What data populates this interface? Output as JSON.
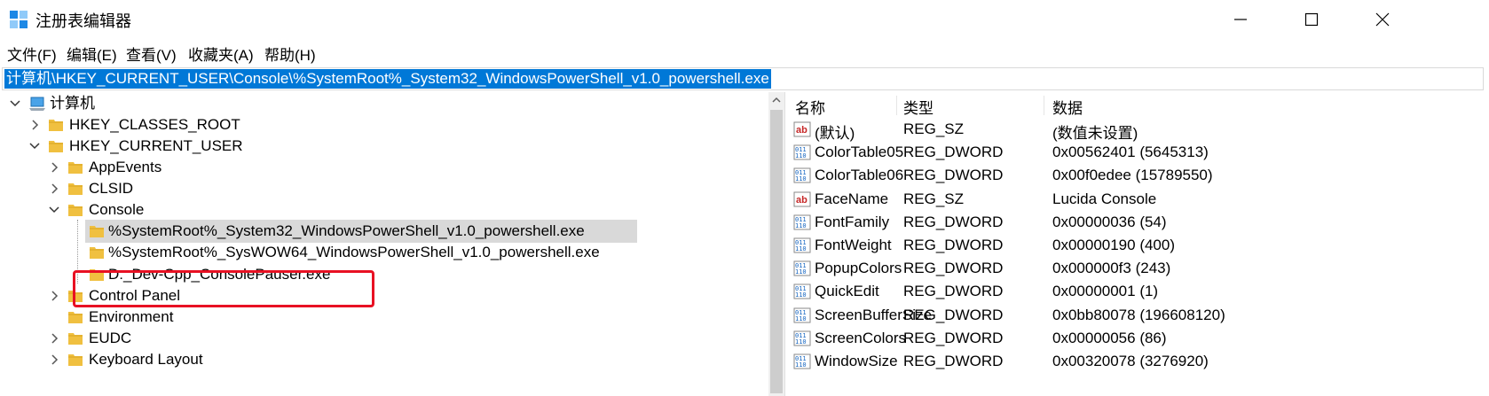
{
  "window": {
    "title": "注册表编辑器"
  },
  "menu": [
    {
      "label": "文件(F)"
    },
    {
      "label": "编辑(E)"
    },
    {
      "label": "查看(V)"
    },
    {
      "label": "收藏夹(A)"
    },
    {
      "label": "帮助(H)"
    }
  ],
  "address": "计算机\\HKEY_CURRENT_USER\\Console\\%SystemRoot%_System32_WindowsPowerShell_v1.0_powershell.exe",
  "tree": {
    "root": "计算机",
    "items": [
      {
        "label": "HKEY_CLASSES_ROOT",
        "state": "collapsed"
      },
      {
        "label": "HKEY_CURRENT_USER",
        "state": "expanded"
      },
      {
        "label": "AppEvents",
        "state": "collapsed"
      },
      {
        "label": "CLSID",
        "state": "collapsed"
      },
      {
        "label": "Console",
        "state": "expanded"
      },
      {
        "label": "%SystemRoot%_System32_WindowsPowerShell_v1.0_powershell.exe",
        "state": "selected"
      },
      {
        "label": "%SystemRoot%_SysWOW64_WindowsPowerShell_v1.0_powershell.exe",
        "state": "leaf"
      },
      {
        "label": "D:_Dev-Cpp_ConsolePauser.exe",
        "state": "leaf"
      },
      {
        "label": "Control Panel",
        "state": "collapsed"
      },
      {
        "label": "Environment",
        "state": "leaf"
      },
      {
        "label": "EUDC",
        "state": "collapsed"
      },
      {
        "label": "Keyboard Layout",
        "state": "collapsed"
      }
    ]
  },
  "columns": {
    "name": "名称",
    "type": "类型",
    "data": "数据"
  },
  "values": [
    {
      "name": "(默认)",
      "type": "REG_SZ",
      "data": "(数值未设置)",
      "icon": "string-value-icon"
    },
    {
      "name": "ColorTable05",
      "type": "REG_DWORD",
      "data": "0x00562401 (5645313)",
      "icon": "binary-value-icon"
    },
    {
      "name": "ColorTable06",
      "type": "REG_DWORD",
      "data": "0x00f0edee (15789550)",
      "icon": "binary-value-icon"
    },
    {
      "name": "FaceName",
      "type": "REG_SZ",
      "data": "Lucida Console",
      "icon": "string-value-icon"
    },
    {
      "name": "FontFamily",
      "type": "REG_DWORD",
      "data": "0x00000036 (54)",
      "icon": "binary-value-icon"
    },
    {
      "name": "FontWeight",
      "type": "REG_DWORD",
      "data": "0x00000190 (400)",
      "icon": "binary-value-icon"
    },
    {
      "name": "PopupColors",
      "type": "REG_DWORD",
      "data": "0x000000f3 (243)",
      "icon": "binary-value-icon"
    },
    {
      "name": "QuickEdit",
      "type": "REG_DWORD",
      "data": "0x00000001 (1)",
      "icon": "binary-value-icon"
    },
    {
      "name": "ScreenBufferSize",
      "type": "REG_DWORD",
      "data": "0x0bb80078 (196608120)",
      "icon": "binary-value-icon"
    },
    {
      "name": "ScreenColors",
      "type": "REG_DWORD",
      "data": "0x00000056 (86)",
      "icon": "binary-value-icon"
    },
    {
      "name": "WindowSize",
      "type": "REG_DWORD",
      "data": "0x00320078 (3276920)",
      "icon": "binary-value-icon"
    }
  ],
  "colors": {
    "selection": "#0078d7",
    "highlight_box": "#e81123",
    "folder": "#f0c040"
  }
}
